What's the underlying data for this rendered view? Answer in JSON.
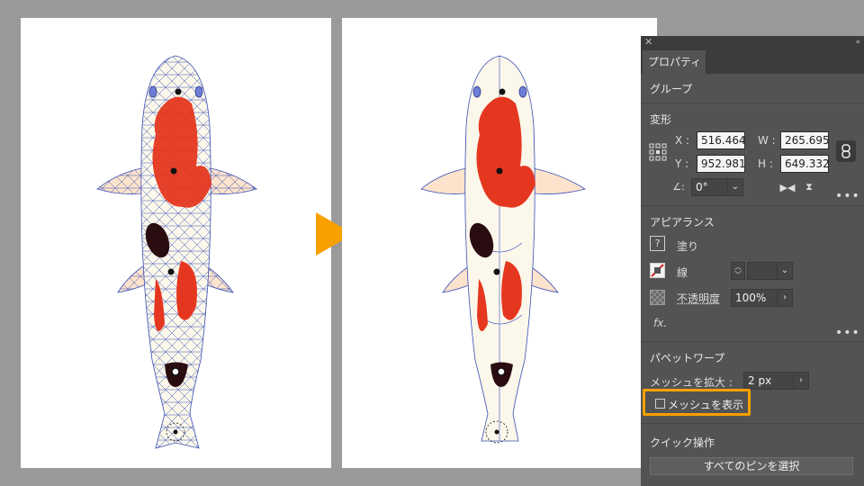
{
  "panel": {
    "tab_label": "プロパティ",
    "group_label": "グループ",
    "transform": {
      "title": "変形",
      "x_label": "X :",
      "x_value": "516.464",
      "y_label": "Y :",
      "y_value": "952.981",
      "w_label": "W :",
      "w_value": "265.695",
      "h_label": "H :",
      "h_value": "649.332",
      "angle_value": "0°"
    },
    "appearance": {
      "title": "アピアランス",
      "fill_label": "塗り",
      "stroke_label": "線",
      "opacity_label": "不透明度",
      "opacity_value": "100%",
      "fx_label": "fx."
    },
    "puppet_warp": {
      "title": "パペットワープ",
      "expand_mesh_label": "メッシュを拡大 :",
      "expand_mesh_value": "2 px",
      "show_mesh_label": "メッシュを表示",
      "show_mesh_checked": false
    },
    "quick_actions": {
      "title": "クイック操作",
      "select_all_pins_label": "すべてのピンを選択"
    }
  },
  "colors": {
    "highlight": "#f7a000",
    "arrow": "#f7a000",
    "koi_red": "#e5371f",
    "koi_black": "#2a0d10",
    "koi_body": "#fbf7ea",
    "fin": "#fde3cc",
    "mesh_line": "#3a4fb8"
  },
  "icons": {
    "close": "close-icon",
    "collapse": "collapse-icon",
    "reference_point": "reference-point-icon",
    "link": "link-icon",
    "angle": "angle-icon",
    "flip_horizontal": "flip-horizontal-icon",
    "flip_vertical": "flip-vertical-icon",
    "fill": "question-fill-icon",
    "stroke": "none-stroke-icon",
    "opacity": "checker-icon",
    "arrow": "right-arrow-icon"
  }
}
